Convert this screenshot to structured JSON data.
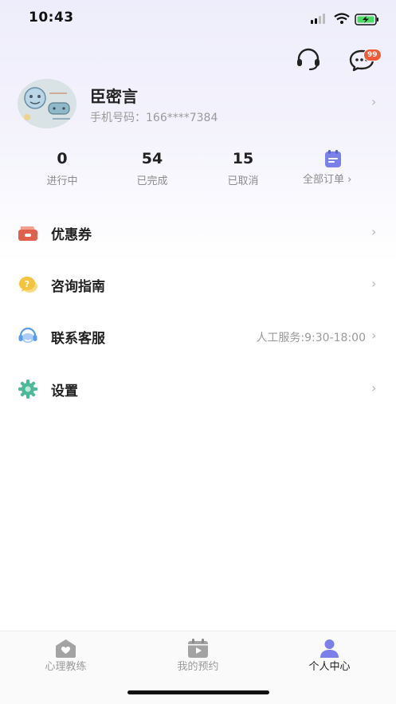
{
  "status_bar": {
    "time": "10:43"
  },
  "header": {
    "support_icon": "headset-icon",
    "message_icon": "chat-bubble-icon",
    "message_badge": "99"
  },
  "profile": {
    "name": "臣密言",
    "phone_label": "手机号码：",
    "phone_value": "166****7384",
    "chevron": "›"
  },
  "stats": [
    {
      "value": "0",
      "label": "进行中"
    },
    {
      "value": "54",
      "label": "已完成"
    },
    {
      "value": "15",
      "label": "已取消"
    }
  ],
  "all_orders": {
    "label": "全部订单 ›",
    "icon": "clipboard-icon"
  },
  "menu": [
    {
      "label": "优惠券",
      "icon": "coupon-icon",
      "sub": "",
      "chevron": "›"
    },
    {
      "label": "咨询指南",
      "icon": "question-bubble-icon",
      "sub": "",
      "chevron": "›"
    },
    {
      "label": "联系客服",
      "icon": "customer-service-icon",
      "sub": "人工服务:9:30-18:00",
      "chevron": "›"
    },
    {
      "label": "设置",
      "icon": "gear-icon",
      "sub": "",
      "chevron": "›"
    }
  ],
  "tabbar": [
    {
      "label": "心理教练",
      "icon": "heart-house-icon",
      "active": false
    },
    {
      "label": "我的预约",
      "icon": "calendar-play-icon",
      "active": false
    },
    {
      "label": "个人中心",
      "icon": "person-icon",
      "active": true
    }
  ],
  "colors": {
    "accent": "#7b7fe8",
    "badge": "#ee5a3a",
    "coupon": "#e0604c",
    "guide": "#f3c43f",
    "service": "#5b9be6",
    "settings": "#4db89a"
  }
}
